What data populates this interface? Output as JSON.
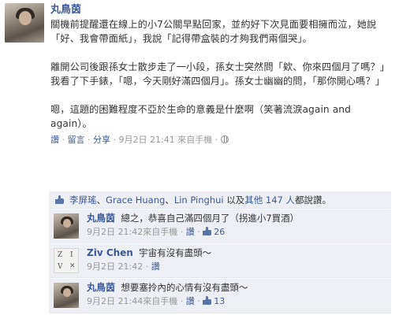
{
  "post": {
    "author": "丸鳥茵",
    "paragraphs": [
      "關機前提醒還在線上的小7公關早點回家，並約好下次見面要相擁而泣，她說「好、我會帶面紙」，我說「記得帶盒裝的才夠我們兩個哭」。",
      "離開公司後跟孫女士散步走了一小段，孫女士突然問「欸、你來四個月了嗎？」我看了下手錶，「嗯，今天剛好滿四個月」。孫女士幽幽的問，「那你開心嗎？」",
      "嗯，這題的困難程度不亞於生命的意義是什麼啊（笑著流淚again and again）。"
    ],
    "meta": {
      "like": "讚",
      "comment": "留言",
      "share": "分享",
      "time": "9月2日 21:41",
      "via": "來自手機",
      "sep": "·"
    }
  },
  "likes": {
    "names": [
      "李屏瑤",
      "Grace Huang",
      "Lin Pinghui"
    ],
    "name_sep": "、",
    "middle": "以及",
    "others": "其他 147 人",
    "suffix": "都說讚。"
  },
  "comments": [
    {
      "name": "丸鳥茵",
      "text": "總之，恭喜自己滿四個月了（拐進小7買酒）",
      "time": "9月2日 21:42",
      "via": "來自手機",
      "like": "讚",
      "count": "26"
    },
    {
      "name": "Ziv Chen",
      "text": "宇宙有沒有盡頭～",
      "time": "9月2日 21:42",
      "via": "",
      "like": "讚",
      "count": ""
    },
    {
      "name": "丸鳥茵",
      "text": "想要塞拎內的心情有沒有盡頭～",
      "time": "9月2日 21:44",
      "via": "來自手機",
      "like": "讚",
      "count": "13"
    }
  ],
  "colors": {
    "link": "#3b5998",
    "meta_gray": "#999999",
    "comment_bg": "#edeff4"
  }
}
